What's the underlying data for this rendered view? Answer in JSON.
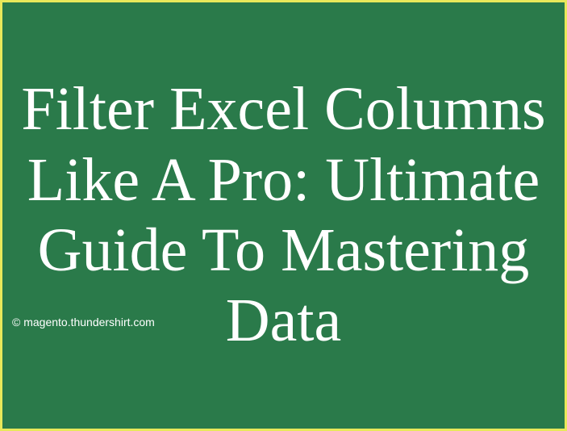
{
  "title": "Filter Excel Columns Like A Pro: Ultimate Guide To Mastering Data",
  "copyright": "© magento.thundershirt.com"
}
